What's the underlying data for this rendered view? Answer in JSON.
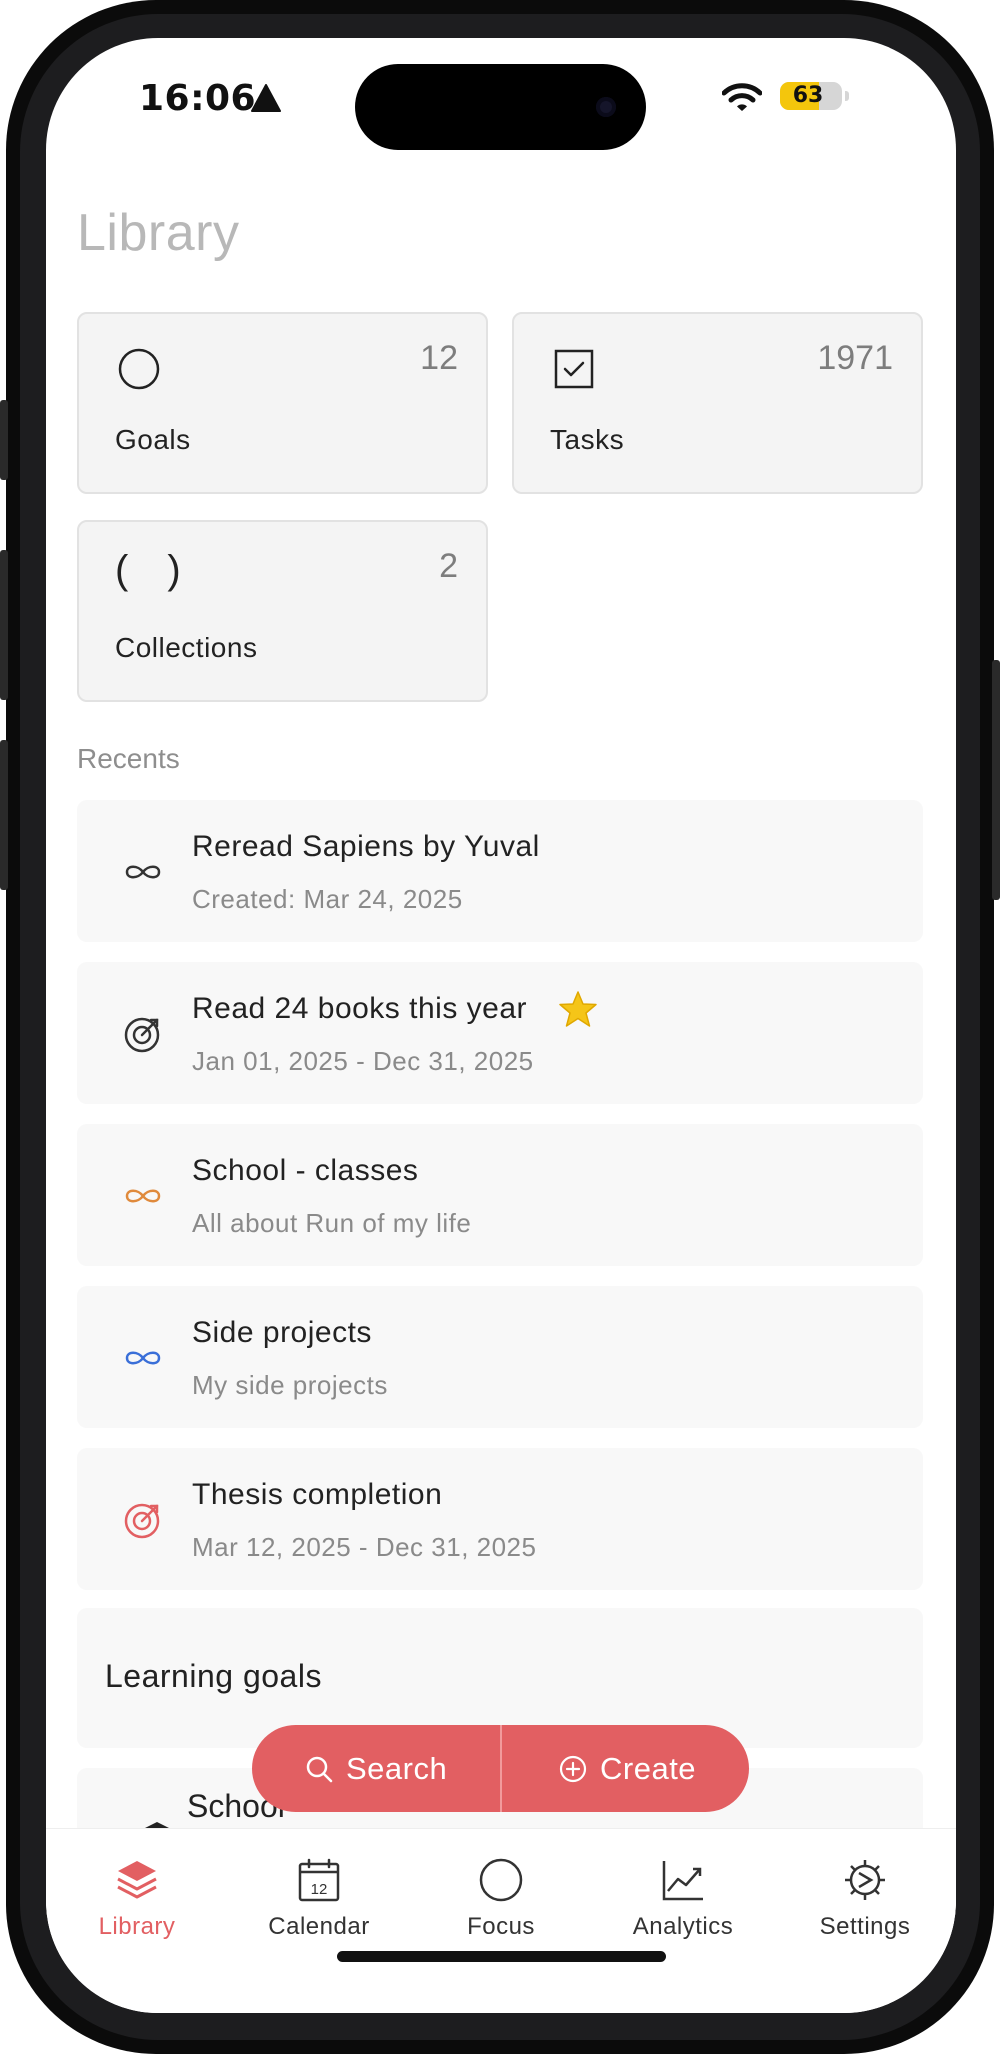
{
  "status_bar": {
    "time": "16:06",
    "battery": "63",
    "battery_level": 0.63
  },
  "page": {
    "title": "Library"
  },
  "cards": [
    {
      "label": "Goals",
      "count": "12",
      "icon": "circle-icon"
    },
    {
      "label": "Tasks",
      "count": "1971",
      "icon": "checkbox-icon"
    },
    {
      "label": "Collections",
      "count": "2",
      "icon": "parentheses-icon"
    }
  ],
  "cards_collections_icon_text": "( )",
  "recents": {
    "label": "Recents",
    "items": [
      {
        "title": "Reread Sapiens by Yuval",
        "subtitle": "Created: Mar 24, 2025",
        "icon": "infinity-icon",
        "color": "#333333"
      },
      {
        "title": "Read 24 books this year",
        "subtitle": "Jan 01, 2025 - Dec 31, 2025",
        "icon": "target-icon",
        "color": "#333333",
        "starred": true
      },
      {
        "title": "School - classes",
        "subtitle": "All about Run of my life",
        "icon": "infinity-icon",
        "color": "#e08a3c"
      },
      {
        "title": "Side projects",
        "subtitle": "My side projects",
        "icon": "infinity-icon",
        "color": "#3a6fd8"
      },
      {
        "title": "Thesis completion",
        "subtitle": "Mar 12, 2025 - Dec 31, 2025",
        "icon": "target-icon",
        "color": "#e25f62"
      }
    ]
  },
  "group": {
    "title": "Learning goals"
  },
  "partial_item": {
    "title": "School"
  },
  "actions": {
    "search_label": "Search",
    "create_label": "Create"
  },
  "tabs": [
    {
      "label": "Library",
      "icon": "layers-icon",
      "active": true
    },
    {
      "label": "Calendar",
      "icon": "calendar-icon",
      "calendar_day": "12"
    },
    {
      "label": "Focus",
      "icon": "circle-icon"
    },
    {
      "label": "Analytics",
      "icon": "chart-icon"
    },
    {
      "label": "Settings",
      "icon": "gear-icon"
    }
  ],
  "colors": {
    "accent": "#e25f62",
    "star": "#f5c518"
  }
}
